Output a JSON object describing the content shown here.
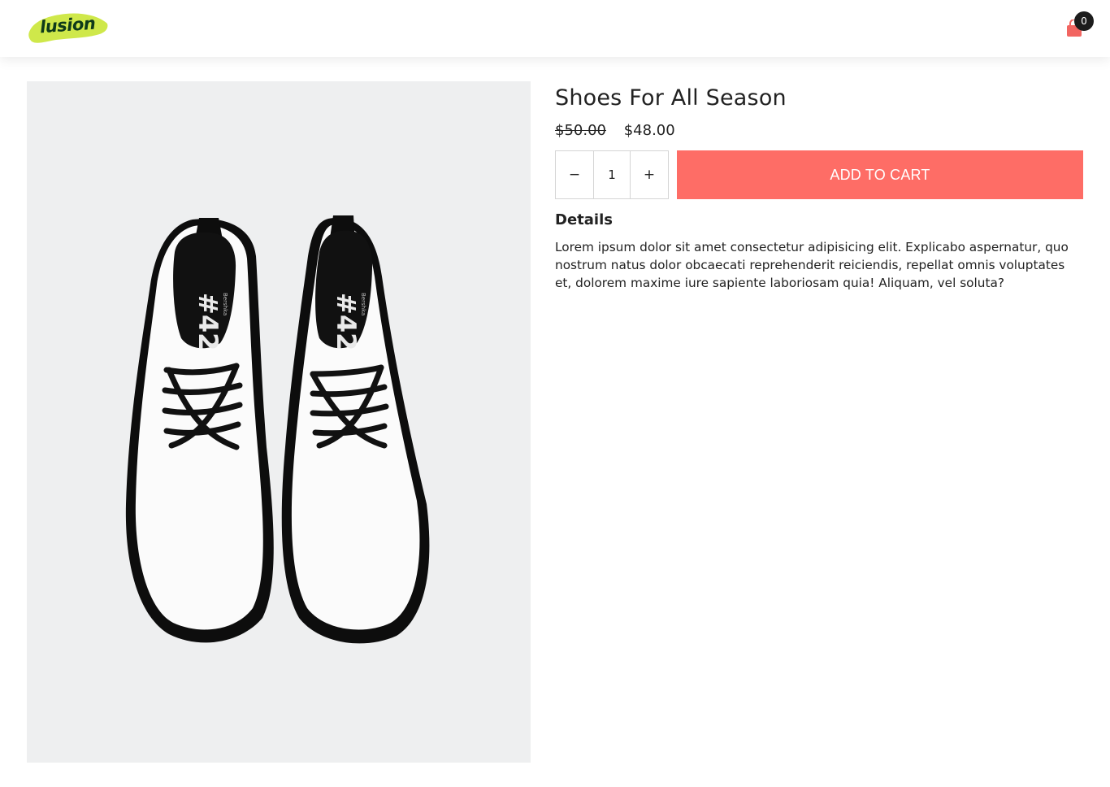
{
  "header": {
    "logo_text": "lusion",
    "cart_count": "0",
    "cart_color": "#f26561"
  },
  "product": {
    "image_alt": "white shoes",
    "title": "Shoes For All Season",
    "old_price": "$50.00",
    "price": "$48.00",
    "quantity": "1",
    "minus_label": "−",
    "plus_label": "+",
    "add_to_cart_label": "ADD TO CART",
    "details_heading": "Details",
    "details_text": "Lorem ipsum dolor sit amet consectetur adipisicing elit. Explicabo aspernatur, quo nostrum natus dolor obcaecati reprehenderit reiciendis, repellat omnis voluptates et, dolorem maxime iure sapiente laboriosam quia! Aliquam, vel soluta?",
    "insole_text": "#42",
    "insole_brand": "Bershka"
  },
  "colors": {
    "accent": "#fe6d66",
    "logo_green": "#cfe84a",
    "image_bg": "#eeeff0"
  }
}
